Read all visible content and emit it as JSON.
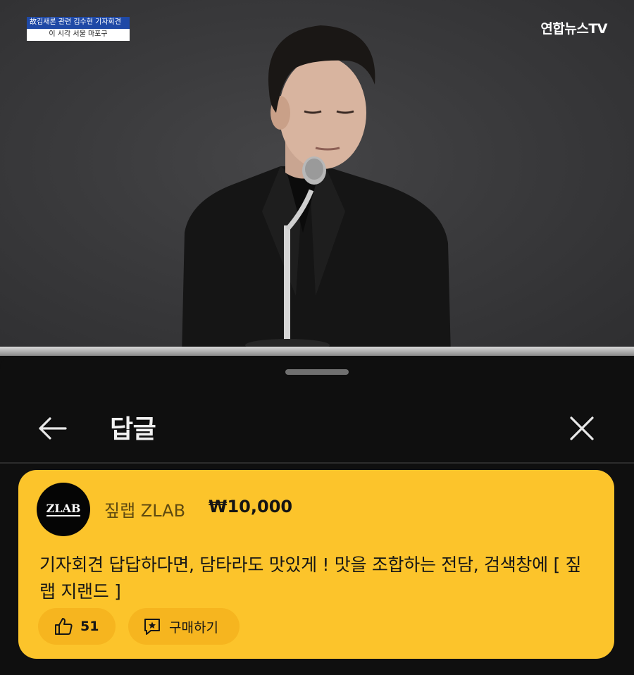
{
  "video": {
    "caption_top": "故김새론 관련 김수현 기자회견",
    "caption_bottom": "이 시각 서울 마포구",
    "broadcaster": "연합뉴스TV"
  },
  "sheet": {
    "title": "답글",
    "back_icon": "arrow-left-icon",
    "close_icon": "close-icon"
  },
  "super_chat": {
    "avatar_text": "ZLAB",
    "author": "짚랩 ZLAB",
    "amount": "₩10,000",
    "message": "기자회견 답답하다면, 담타라도 맛있게 ! 맛을 조합하는 전담, 검색창에 [ 짚랩 지랜드 ]",
    "like_count": "51",
    "buy_label": "구매하기",
    "card_color": "#fcc42b",
    "pill_color": "#f6b51f"
  },
  "colors": {
    "background": "#0f0f0f",
    "caption_blue": "#1f49a6"
  }
}
